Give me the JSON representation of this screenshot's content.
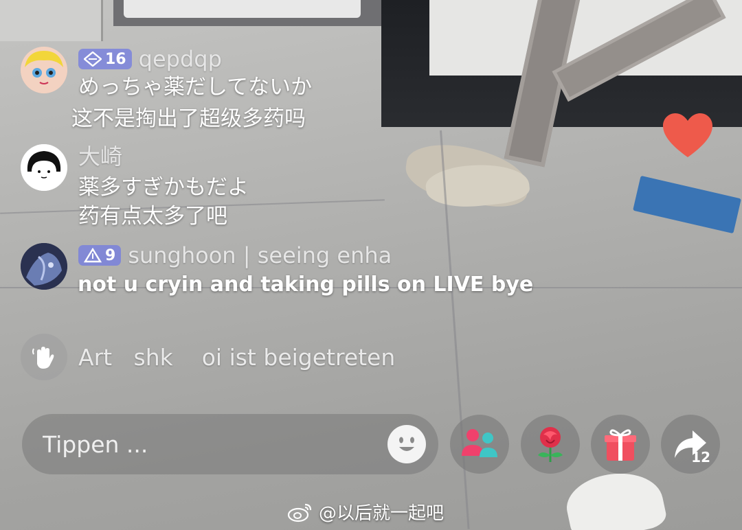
{
  "comments": [
    {
      "level": "16",
      "username": "qepdqp",
      "lines": [
        "めっちゃ薬だしてないか",
        "这不是掏出了超级多药吗"
      ]
    },
    {
      "username": "大崎",
      "lines": [
        "薬多すぎかもだよ",
        "药有点太多了吧"
      ]
    },
    {
      "level": "9",
      "username": "sunghoon | seeing enha",
      "lines": [
        "not u cryin and taking pills on LIVE bye"
      ]
    }
  ],
  "join_notice": "Art   shk    oi ist beigetreten",
  "input": {
    "placeholder": "Tippen ..."
  },
  "actions": {
    "share_count": "12"
  },
  "watermark": "@以后就一起吧",
  "colors": {
    "badge": "#717be2",
    "heart": "#ee5a4b",
    "gift": "#f04f5f",
    "multiguest_pink": "#f0416c",
    "multiguest_teal": "#3fc6c6"
  },
  "icons": [
    "heart-icon",
    "wave-icon",
    "emoji-icon",
    "multi-guest-icon",
    "rose-icon",
    "gift-icon",
    "share-icon",
    "weibo-icon"
  ]
}
